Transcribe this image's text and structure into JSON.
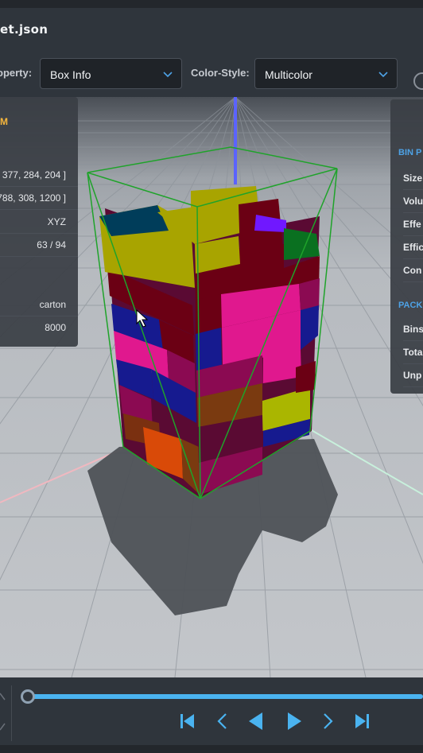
{
  "header": {
    "file_title": "et.json"
  },
  "toolbar": {
    "property_label": "operty:",
    "property_value": "Box Info",
    "color_style_label": "Color-Style:",
    "color_style_value": "Multicolor"
  },
  "left_panel": {
    "title": "M",
    "rows": [
      "[ 377, 284, 204 ]",
      "788, 308, 1200 ]",
      "XYZ",
      "63 / 94",
      "carton",
      "8000"
    ]
  },
  "right_panel": {
    "section_bin": "BIN P",
    "bin_rows": [
      "Size",
      "Volu",
      "Effe",
      "Effic",
      "Con"
    ],
    "section_pack": "PACK",
    "pack_rows": [
      "Bins",
      "Tota",
      "Unp"
    ]
  },
  "playback": {
    "progress": 0.0
  },
  "colors": {
    "accent": "#4ab3f0",
    "panel_title": "#f6b73c",
    "section": "#4ea2e6"
  }
}
